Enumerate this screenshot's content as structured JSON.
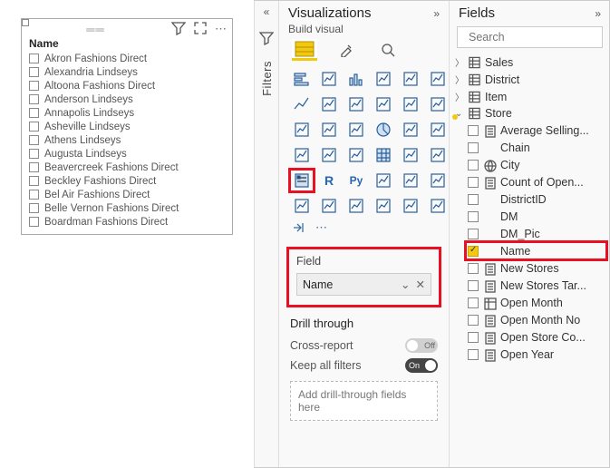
{
  "slicer": {
    "title": "Name",
    "items": [
      "Akron Fashions Direct",
      "Alexandria Lindseys",
      "Altoona Fashions Direct",
      "Anderson Lindseys",
      "Annapolis Lindseys",
      "Asheville Lindseys",
      "Athens Lindseys",
      "Augusta Lindseys",
      "Beavercreek Fashions Direct",
      "Beckley Fashions Direct",
      "Bel Air Fashions Direct",
      "Belle Vernon Fashions Direct",
      "Boardman Fashions Direct"
    ]
  },
  "filters_label": "Filters",
  "viz": {
    "title": "Visualizations",
    "subtitle": "Build visual",
    "field_section_label": "Field",
    "field_pill": "Name",
    "drill_label": "Drill through",
    "cross_report_label": "Cross-report",
    "cross_report_state": "Off",
    "keep_all_label": "Keep all filters",
    "keep_all_state": "On",
    "drop_placeholder": "Add drill-through fields here"
  },
  "fields": {
    "title": "Fields",
    "search_placeholder": "Search",
    "tables": {
      "sales": "Sales",
      "district": "District",
      "item": "Item",
      "store": "Store"
    },
    "store_fields": [
      {
        "label": "Average Selling...",
        "kind": "measure",
        "checked": false
      },
      {
        "label": "Chain",
        "kind": "column",
        "checked": false
      },
      {
        "label": "City",
        "kind": "geo",
        "checked": false
      },
      {
        "label": "Count of Open...",
        "kind": "measure",
        "checked": false
      },
      {
        "label": "DistrictID",
        "kind": "column",
        "checked": false
      },
      {
        "label": "DM",
        "kind": "column",
        "checked": false
      },
      {
        "label": "DM_Pic",
        "kind": "column",
        "checked": false
      },
      {
        "label": "Name",
        "kind": "column",
        "checked": true,
        "hl": true
      },
      {
        "label": "New Stores",
        "kind": "measure",
        "checked": false
      },
      {
        "label": "New Stores Tar...",
        "kind": "measure",
        "checked": false
      },
      {
        "label": "Open Month",
        "kind": "hier",
        "checked": false
      },
      {
        "label": "Open Month No",
        "kind": "measure",
        "checked": false
      },
      {
        "label": "Open Store Co...",
        "kind": "measure",
        "checked": false
      },
      {
        "label": "Open Year",
        "kind": "measure",
        "checked": false
      }
    ]
  }
}
